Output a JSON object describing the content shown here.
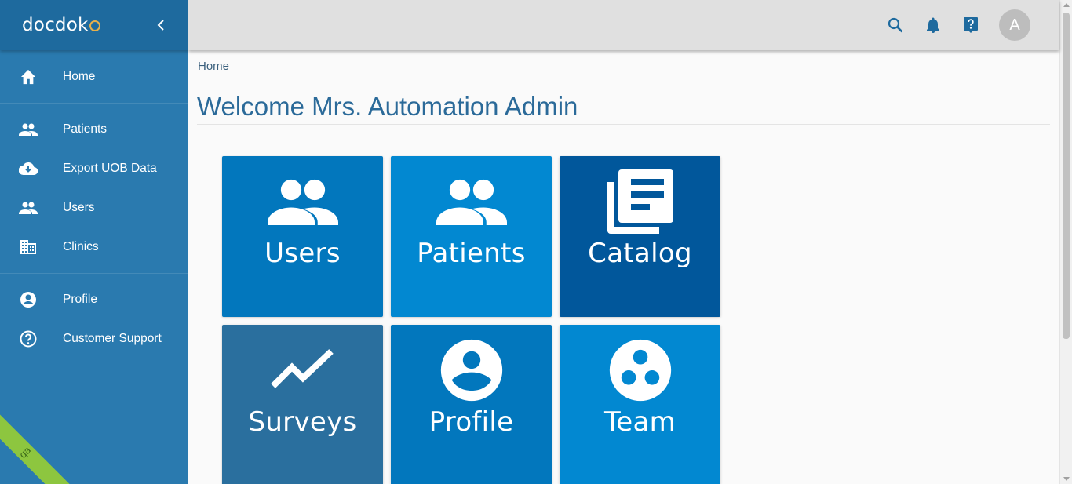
{
  "app": {
    "logo": "docdok"
  },
  "sidebar": {
    "items": [
      {
        "label": "Home",
        "icon": "home-icon"
      },
      {
        "label": "Patients",
        "icon": "people-icon"
      },
      {
        "label": "Export UOB Data",
        "icon": "cloud-download-icon"
      },
      {
        "label": "Users",
        "icon": "people-icon"
      },
      {
        "label": "Clinics",
        "icon": "building-icon"
      },
      {
        "label": "Profile",
        "icon": "account-circle-icon"
      },
      {
        "label": "Customer Support",
        "icon": "help-circle-icon"
      }
    ],
    "env_badge": "qa"
  },
  "topbar": {
    "icons": [
      "search-icon",
      "bell-icon",
      "help-icon"
    ],
    "avatar_initial": "A"
  },
  "breadcrumb": "Home",
  "page_title": "Welcome Mrs. Automation Admin",
  "tiles": [
    {
      "label": "Users",
      "icon": "people-icon",
      "color": "#0277bd"
    },
    {
      "label": "Patients",
      "icon": "people-icon",
      "color": "#0288d1"
    },
    {
      "label": "Catalog",
      "icon": "catalog-icon",
      "color": "#01579b"
    },
    {
      "label": "Surveys",
      "icon": "trending-up-icon",
      "color": "#2a6f9e"
    },
    {
      "label": "Profile",
      "icon": "account-circle-icon",
      "color": "#0277bd"
    },
    {
      "label": "Team",
      "icon": "team-icon",
      "color": "#0288d1"
    }
  ],
  "colors": {
    "sidebar": "#2a7aaf",
    "sidebar_header": "#1e6a9e",
    "topbar": "#e0e0e0",
    "title": "#2b6a99",
    "qa_badge": "#8dc63f"
  }
}
